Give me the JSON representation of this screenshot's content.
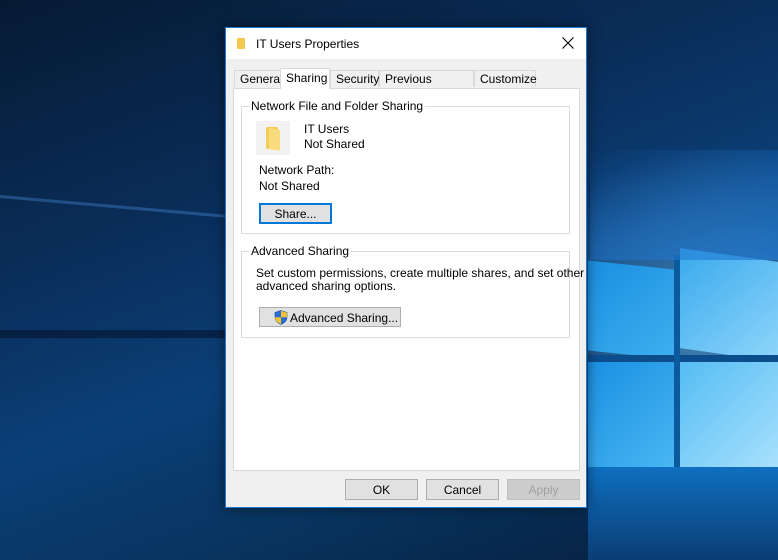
{
  "window": {
    "title": "IT Users Properties",
    "close_label": "Close",
    "folder_icon": "folder-icon"
  },
  "tabs": [
    {
      "label": "General",
      "active": false
    },
    {
      "label": "Sharing",
      "active": true
    },
    {
      "label": "Security",
      "active": false
    },
    {
      "label": "Previous Versions",
      "active": false
    },
    {
      "label": "Customize",
      "active": false
    }
  ],
  "network_sharing": {
    "group_label": "Network File and Folder Sharing",
    "folder_name": "IT Users",
    "share_status": "Not Shared",
    "network_path_label": "Network Path:",
    "network_path_value": "Not Shared",
    "share_button": "Share..."
  },
  "advanced_sharing": {
    "group_label": "Advanced Sharing",
    "description_line1": "Set custom permissions, create multiple shares, and set other",
    "description_line2": "advanced sharing options.",
    "button_label": "Advanced Sharing...",
    "button_icon": "uac-shield-icon"
  },
  "footer": {
    "ok": "OK",
    "cancel": "Cancel",
    "apply": "Apply",
    "apply_disabled": true
  },
  "annotation": {
    "highlight_color": "#ec0b0b"
  }
}
